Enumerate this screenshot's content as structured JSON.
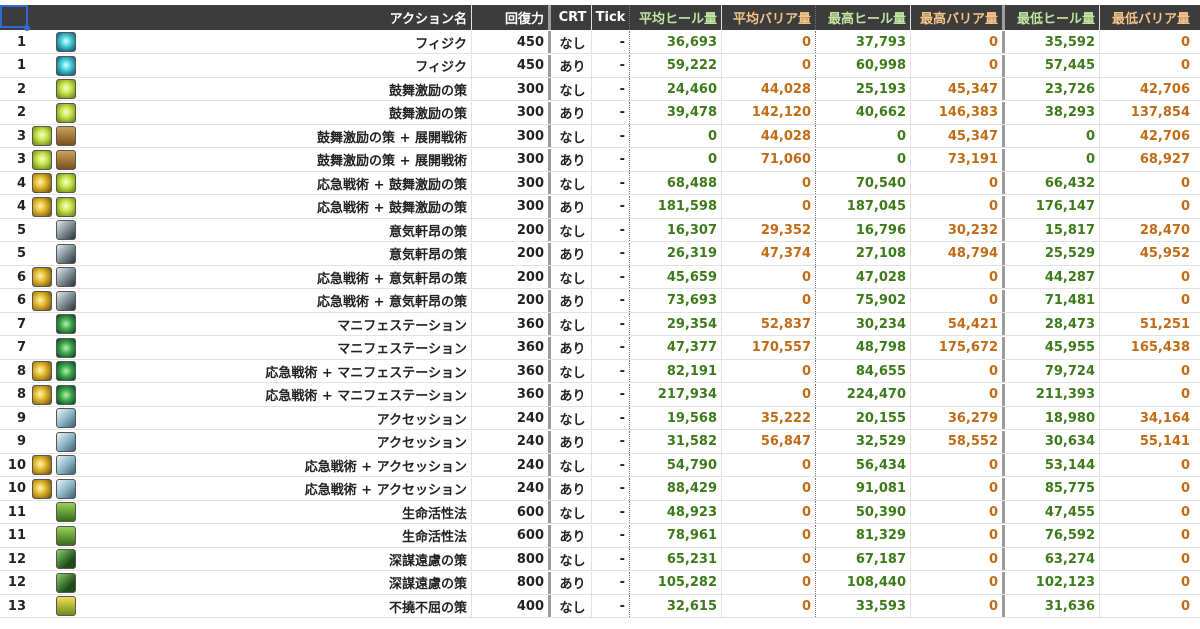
{
  "header": {
    "name": "アクション名",
    "amount": "回復力",
    "crt": "CRT",
    "tick": "Tick",
    "avg_heal": "平均ヒール量",
    "avg_barrier": "平均バリア量",
    "max_heal": "最高ヒール量",
    "max_barrier": "最高バリア量",
    "min_heal": "最低ヒール量",
    "min_barrier": "最低バリア量"
  },
  "colors": {
    "heal": "#3d7a1a",
    "barrier": "#c06b16",
    "header_bg": "#3c3c3c",
    "selection": "#2a6bd6"
  },
  "rows": [
    {
      "no": "1",
      "icons": [
        "",
        "physick-icon"
      ],
      "name": "フィジク",
      "amt": "450",
      "crt": "なし",
      "tick": "-",
      "h1": "36,693",
      "b1": "0",
      "h2": "37,793",
      "b2": "0",
      "h3": "35,592",
      "b3": "0"
    },
    {
      "no": "1",
      "icons": [
        "",
        "physick-icon"
      ],
      "name": "フィジク",
      "amt": "450",
      "crt": "あり",
      "tick": "-",
      "h1": "59,222",
      "b1": "0",
      "h2": "60,998",
      "b2": "0",
      "h3": "57,445",
      "b3": "0"
    },
    {
      "no": "2",
      "icons": [
        "",
        "adloquium-icon"
      ],
      "name": "鼓舞激励の策",
      "amt": "300",
      "crt": "なし",
      "tick": "-",
      "h1": "24,460",
      "b1": "44,028",
      "h2": "25,193",
      "b2": "45,347",
      "h3": "23,726",
      "b3": "42,706"
    },
    {
      "no": "2",
      "icons": [
        "",
        "adloquium-icon"
      ],
      "name": "鼓舞激励の策",
      "amt": "300",
      "crt": "あり",
      "tick": "-",
      "h1": "39,478",
      "b1": "142,120",
      "h2": "40,662",
      "b2": "146,383",
      "h3": "38,293",
      "b3": "137,854"
    },
    {
      "no": "3",
      "icons": [
        "adloquium-icon",
        "deployment-tactics-icon"
      ],
      "name": "鼓舞激励の策 + 展開戦術",
      "amt": "300",
      "crt": "なし",
      "tick": "-",
      "h1": "0",
      "b1": "44,028",
      "h2": "0",
      "b2": "45,347",
      "h3": "0",
      "b3": "42,706"
    },
    {
      "no": "3",
      "icons": [
        "adloquium-icon",
        "deployment-tactics-icon"
      ],
      "name": "鼓舞激励の策 + 展開戦術",
      "amt": "300",
      "crt": "あり",
      "tick": "-",
      "h1": "0",
      "b1": "71,060",
      "h2": "0",
      "b2": "73,191",
      "h3": "0",
      "b3": "68,927"
    },
    {
      "no": "4",
      "icons": [
        "emergency-tactics-icon",
        "adloquium-icon"
      ],
      "name": "応急戦術 + 鼓舞激励の策",
      "amt": "300",
      "crt": "なし",
      "tick": "-",
      "h1": "68,488",
      "b1": "0",
      "h2": "70,540",
      "b2": "0",
      "h3": "66,432",
      "b3": "0"
    },
    {
      "no": "4",
      "icons": [
        "emergency-tactics-icon",
        "adloquium-icon"
      ],
      "name": "応急戦術 + 鼓舞激励の策",
      "amt": "300",
      "crt": "あり",
      "tick": "-",
      "h1": "181,598",
      "b1": "0",
      "h2": "187,045",
      "b2": "0",
      "h3": "176,147",
      "b3": "0"
    },
    {
      "no": "5",
      "icons": [
        "",
        "succor-icon"
      ],
      "name": "意気軒昂の策",
      "amt": "200",
      "crt": "なし",
      "tick": "-",
      "h1": "16,307",
      "b1": "29,352",
      "h2": "16,796",
      "b2": "30,232",
      "h3": "15,817",
      "b3": "28,470"
    },
    {
      "no": "5",
      "icons": [
        "",
        "succor-icon"
      ],
      "name": "意気軒昂の策",
      "amt": "200",
      "crt": "あり",
      "tick": "-",
      "h1": "26,319",
      "b1": "47,374",
      "h2": "27,108",
      "b2": "48,794",
      "h3": "25,529",
      "b3": "45,952"
    },
    {
      "no": "6",
      "icons": [
        "emergency-tactics-icon",
        "succor-icon"
      ],
      "name": "応急戦術 + 意気軒昂の策",
      "amt": "200",
      "crt": "なし",
      "tick": "-",
      "h1": "45,659",
      "b1": "0",
      "h2": "47,028",
      "b2": "0",
      "h3": "44,287",
      "b3": "0"
    },
    {
      "no": "6",
      "icons": [
        "emergency-tactics-icon",
        "succor-icon"
      ],
      "name": "応急戦術 + 意気軒昂の策",
      "amt": "200",
      "crt": "あり",
      "tick": "-",
      "h1": "73,693",
      "b1": "0",
      "h2": "75,902",
      "b2": "0",
      "h3": "71,481",
      "b3": "0"
    },
    {
      "no": "7",
      "icons": [
        "",
        "manifestation-icon"
      ],
      "name": "マニフェステーション",
      "amt": "360",
      "crt": "なし",
      "tick": "-",
      "h1": "29,354",
      "b1": "52,837",
      "h2": "30,234",
      "b2": "54,421",
      "h3": "28,473",
      "b3": "51,251"
    },
    {
      "no": "7",
      "icons": [
        "",
        "manifestation-icon"
      ],
      "name": "マニフェステーション",
      "amt": "360",
      "crt": "あり",
      "tick": "-",
      "h1": "47,377",
      "b1": "170,557",
      "h2": "48,798",
      "b2": "175,672",
      "h3": "45,955",
      "b3": "165,438"
    },
    {
      "no": "8",
      "icons": [
        "emergency-tactics-icon",
        "manifestation-icon"
      ],
      "name": "応急戦術 + マニフェステーション",
      "amt": "360",
      "crt": "なし",
      "tick": "-",
      "h1": "82,191",
      "b1": "0",
      "h2": "84,655",
      "b2": "0",
      "h3": "79,724",
      "b3": "0"
    },
    {
      "no": "8",
      "icons": [
        "emergency-tactics-icon",
        "manifestation-icon"
      ],
      "name": "応急戦術 + マニフェステーション",
      "amt": "360",
      "crt": "あり",
      "tick": "-",
      "h1": "217,934",
      "b1": "0",
      "h2": "224,470",
      "b2": "0",
      "h3": "211,393",
      "b3": "0"
    },
    {
      "no": "9",
      "icons": [
        "",
        "accession-icon"
      ],
      "name": "アクセッション",
      "amt": "240",
      "crt": "なし",
      "tick": "-",
      "h1": "19,568",
      "b1": "35,222",
      "h2": "20,155",
      "b2": "36,279",
      "h3": "18,980",
      "b3": "34,164"
    },
    {
      "no": "9",
      "icons": [
        "",
        "accession-icon"
      ],
      "name": "アクセッション",
      "amt": "240",
      "crt": "あり",
      "tick": "-",
      "h1": "31,582",
      "b1": "56,847",
      "h2": "32,529",
      "b2": "58,552",
      "h3": "30,634",
      "b3": "55,141"
    },
    {
      "no": "10",
      "icons": [
        "emergency-tactics-icon",
        "accession-icon"
      ],
      "name": "応急戦術 + アクセッション",
      "amt": "240",
      "crt": "なし",
      "tick": "-",
      "h1": "54,790",
      "b1": "0",
      "h2": "56,434",
      "b2": "0",
      "h3": "53,144",
      "b3": "0"
    },
    {
      "no": "10",
      "icons": [
        "emergency-tactics-icon",
        "accession-icon"
      ],
      "name": "応急戦術 + アクセッション",
      "amt": "240",
      "crt": "あり",
      "tick": "-",
      "h1": "88,429",
      "b1": "0",
      "h2": "91,081",
      "b2": "0",
      "h3": "85,775",
      "b3": "0"
    },
    {
      "no": "11",
      "icons": [
        "",
        "lustrate-icon"
      ],
      "name": "生命活性法",
      "amt": "600",
      "crt": "なし",
      "tick": "-",
      "h1": "48,923",
      "b1": "0",
      "h2": "50,390",
      "b2": "0",
      "h3": "47,455",
      "b3": "0"
    },
    {
      "no": "11",
      "icons": [
        "",
        "lustrate-icon"
      ],
      "name": "生命活性法",
      "amt": "600",
      "crt": "あり",
      "tick": "-",
      "h1": "78,961",
      "b1": "0",
      "h2": "81,329",
      "b2": "0",
      "h3": "76,592",
      "b3": "0"
    },
    {
      "no": "12",
      "icons": [
        "",
        "excogitation-icon"
      ],
      "name": "深謀遠慮の策",
      "amt": "800",
      "crt": "なし",
      "tick": "-",
      "h1": "65,231",
      "b1": "0",
      "h2": "67,187",
      "b2": "0",
      "h3": "63,274",
      "b3": "0"
    },
    {
      "no": "12",
      "icons": [
        "",
        "excogitation-icon"
      ],
      "name": "深謀遠慮の策",
      "amt": "800",
      "crt": "あり",
      "tick": "-",
      "h1": "105,282",
      "b1": "0",
      "h2": "108,440",
      "b2": "0",
      "h3": "102,123",
      "b3": "0"
    },
    {
      "no": "13",
      "icons": [
        "",
        "indomitability-icon"
      ],
      "name": "不撓不屈の策",
      "amt": "400",
      "crt": "なし",
      "tick": "-",
      "h1": "32,615",
      "b1": "0",
      "h2": "33,593",
      "b2": "0",
      "h3": "31,636",
      "b3": "0"
    }
  ]
}
